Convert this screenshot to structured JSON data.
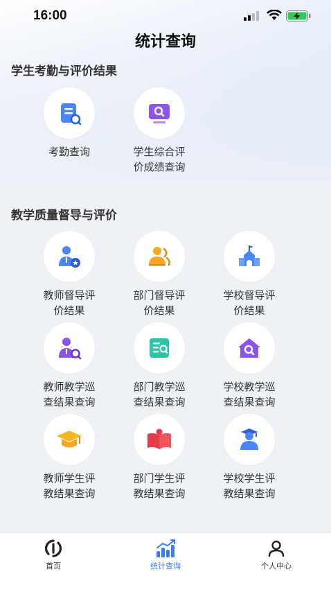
{
  "status_bar": {
    "time": "16:00"
  },
  "page": {
    "title": "统计查询"
  },
  "sections": [
    {
      "title": "学生考勤与评价结果",
      "items": [
        {
          "label": "考勤查询",
          "icon": "clipboard-search-icon"
        },
        {
          "label": "学生综合评\n价成绩查询",
          "icon": "monitor-search-icon"
        }
      ]
    },
    {
      "title": "教学质量督导与评价",
      "items": [
        {
          "label": "教师督导评\n价结果",
          "icon": "teacher-badge-icon"
        },
        {
          "label": "部门督导评\n价结果",
          "icon": "group-icon"
        },
        {
          "label": "学校督导评\n价结果",
          "icon": "school-building-icon"
        },
        {
          "label": "教师教学巡\n查结果查询",
          "icon": "teacher-search-icon"
        },
        {
          "label": "部门教学巡\n查结果查询",
          "icon": "document-search-icon"
        },
        {
          "label": "学校教学巡\n查结果查询",
          "icon": "house-search-icon"
        },
        {
          "label": "教师学生评\n教结果查询",
          "icon": "graduation-cap-icon"
        },
        {
          "label": "部门学生评\n教结果查询",
          "icon": "open-book-icon"
        },
        {
          "label": "学校学生评\n教结果查询",
          "icon": "graduate-person-icon"
        }
      ]
    }
  ],
  "tabbar": {
    "items": [
      {
        "label": "首页",
        "icon": "home-logo-icon"
      },
      {
        "label": "统计查询",
        "icon": "statistics-chart-icon",
        "active": true
      },
      {
        "label": "个人中心",
        "icon": "person-icon"
      }
    ]
  },
  "colors": {
    "accent": "#3b7cf5",
    "purple": "#7b4ee0",
    "orange": "#f5a623",
    "red": "#e83b46",
    "teal": "#2cc4a4"
  }
}
